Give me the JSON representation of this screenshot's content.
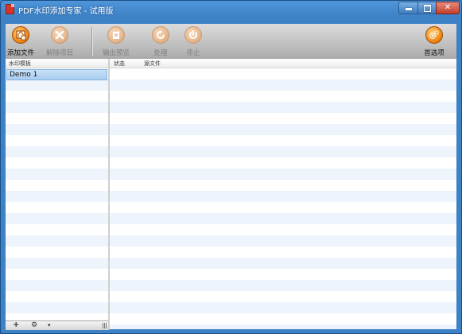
{
  "window": {
    "title": "PDF水印添加专家 - 试用版",
    "controls": {
      "minimize": "minimize",
      "maximize": "maximize",
      "close": "✕"
    }
  },
  "toolbar": {
    "add_file": {
      "label": "添加文件",
      "icon": "add-file-icon",
      "enabled": true
    },
    "remove_item": {
      "label": "解除项目",
      "icon": "remove-x-icon",
      "enabled": false
    },
    "export_preview": {
      "label": "输出预览",
      "icon": "export-icon",
      "enabled": false
    },
    "process": {
      "label": "处理",
      "icon": "refresh-icon",
      "enabled": false
    },
    "stop": {
      "label": "停止",
      "icon": "power-icon",
      "enabled": false
    },
    "preferences": {
      "label": "首选项",
      "icon": "gears-icon",
      "enabled": true
    }
  },
  "left_panel": {
    "header": "水印模板",
    "items": [
      {
        "label": "Demo 1",
        "selected": true
      }
    ],
    "footer": {
      "add": "+",
      "settings": "⚙",
      "dropdown": "▾"
    }
  },
  "right_panel": {
    "columns": [
      {
        "label": "状态"
      },
      {
        "label": "源文件"
      }
    ],
    "rows": []
  },
  "colors": {
    "title_bar": "#3e82c6",
    "accent_orange": "#f08a18",
    "selection": "#a9cdef",
    "row_stripe": "#eef4fb"
  }
}
